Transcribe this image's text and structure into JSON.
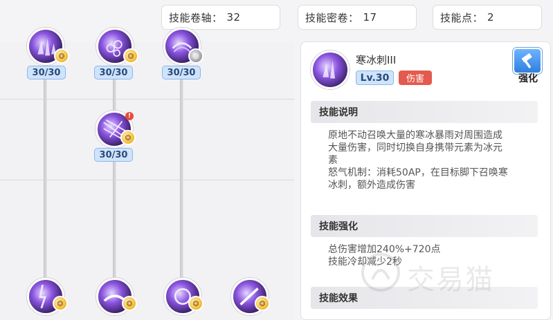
{
  "resources": [
    {
      "label": "技能卷轴：",
      "value": "32"
    },
    {
      "label": "技能密卷：",
      "value": "17"
    },
    {
      "label": "技能点：",
      "value": "2"
    }
  ],
  "tree": {
    "levels": [
      "30/30",
      "30/30",
      "30/30",
      "30/30"
    ],
    "badges": {
      "star": "❂",
      "alert": "!"
    }
  },
  "detail": {
    "skill_name": "寒冰刺III",
    "level": "Lv.30",
    "type_tag": "伤害",
    "strengthen_label": "强化",
    "sections": {
      "desc_title": "技能说明",
      "desc_lines": [
        "原地不动召唤大量的寒冰暴雨对周围造成",
        "大量伤害，同时切换自身携带元素为冰元",
        "素",
        "怒气机制：消耗50AP，在目标脚下召唤寒",
        "冰刺，额外造成伤害"
      ],
      "enh_title": "技能强化",
      "enh_lines": [
        "总伤害增加240%+720点",
        "技能冷却减少2秒"
      ],
      "effect_title": "技能效果"
    },
    "watermark": "交易猫"
  },
  "colors": {
    "accent_blue": "#cfe3fb",
    "damage_red": "#e35a4e",
    "skill_purple": "#8b55e0"
  }
}
